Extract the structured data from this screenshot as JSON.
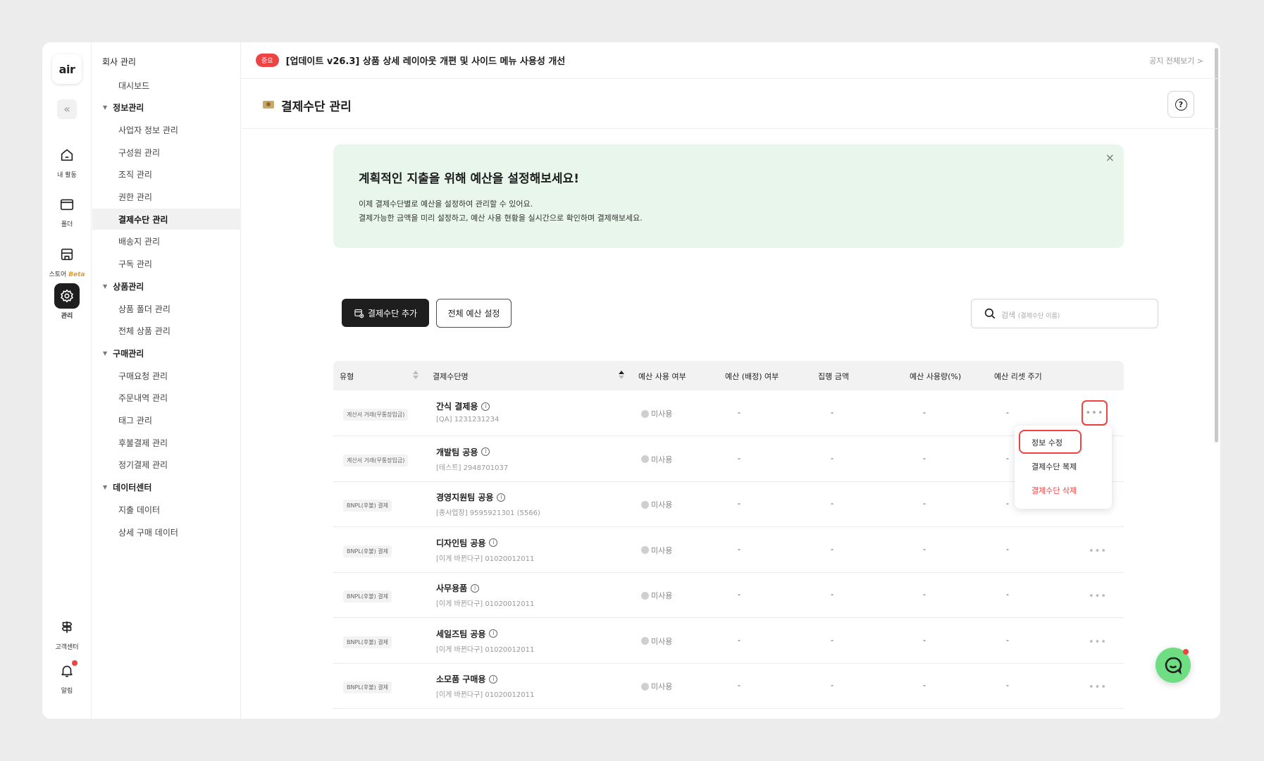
{
  "rail": {
    "logo": "air",
    "items": [
      {
        "label": "내 활동",
        "icon": "home-icon"
      },
      {
        "label": "폴더",
        "icon": "folder-icon"
      },
      {
        "label": "스토어",
        "badge": "Beta",
        "icon": "store-icon"
      },
      {
        "label": "관리",
        "icon": "gear-icon"
      }
    ],
    "bottom": [
      {
        "label": "고객센터",
        "icon": "signpost-icon"
      },
      {
        "label": "알림",
        "icon": "bell-icon"
      }
    ]
  },
  "sidebar": {
    "title": "회사 관리",
    "items": [
      {
        "label": "대시보드",
        "type": "sub"
      },
      {
        "label": "정보관리",
        "type": "section"
      },
      {
        "label": "사업자 정보 관리",
        "type": "sub"
      },
      {
        "label": "구성원 관리",
        "type": "sub"
      },
      {
        "label": "조직 관리",
        "type": "sub"
      },
      {
        "label": "권한 관리",
        "type": "sub"
      },
      {
        "label": "결제수단 관리",
        "type": "sub",
        "active": true
      },
      {
        "label": "배송지 관리",
        "type": "sub"
      },
      {
        "label": "구독 관리",
        "type": "sub"
      },
      {
        "label": "상품관리",
        "type": "section"
      },
      {
        "label": "상품 폴더 관리",
        "type": "sub"
      },
      {
        "label": "전체 상품 관리",
        "type": "sub"
      },
      {
        "label": "구매관리",
        "type": "section"
      },
      {
        "label": "구매요청 관리",
        "type": "sub"
      },
      {
        "label": "주문내역 관리",
        "type": "sub"
      },
      {
        "label": "태그 관리",
        "type": "sub"
      },
      {
        "label": "후불결제 관리",
        "type": "sub"
      },
      {
        "label": "정기결제 관리",
        "type": "sub"
      },
      {
        "label": "데이터센터",
        "type": "section"
      },
      {
        "label": "지출 데이터",
        "type": "sub"
      },
      {
        "label": "상세 구매 데이터",
        "type": "sub"
      }
    ]
  },
  "notice": {
    "badge": "중요",
    "text": "[업데이트 v26.3] 상품 상세 레이아웃 개편 및 사이드 메뉴 사용성 개선",
    "view_all": "공지 전체보기 >"
  },
  "page": {
    "title": "결제수단 관리"
  },
  "banner": {
    "title": "계획적인 지출을 위해 예산을 설정해보세요!",
    "line1": "이제 결제수단별로 예산을 설정하여 관리할 수 있어요.",
    "line2": "결제가능한 금액을 미리 설정하고, 예산 사용 현황을 실시간으로 확인하며 결제해보세요."
  },
  "actions": {
    "add": "결제수단 추가",
    "budget": "전체 예산 설정"
  },
  "search": {
    "placeholder": "검색",
    "hint": "(결제수단 이름)"
  },
  "table": {
    "columns": [
      "유형",
      "결제수단명",
      "예산 사용 여부",
      "예산 (배정) 여부",
      "집행 금액",
      "예산 사용량(%)",
      "예산 리셋 주기"
    ],
    "rows": [
      {
        "type": "계산서 거래(무통장입금)",
        "name": "간식 결제용",
        "sub": "[QA] 1231231234",
        "use": "미사용",
        "assigned": "-",
        "amount": "-",
        "usage": "-",
        "reset": "-"
      },
      {
        "type": "계산서 거래(무통장입금)",
        "name": "개발팀 공용",
        "sub": "[테스트] 2948701037",
        "use": "미사용",
        "assigned": "-",
        "amount": "-",
        "usage": "-",
        "reset": "-"
      },
      {
        "type": "BNPL(후불) 결제",
        "name": "경영지원팀 공용",
        "sub": "[종사업장] 9595921301 (5566)",
        "use": "미사용",
        "assigned": "-",
        "amount": "-",
        "usage": "-",
        "reset": "-"
      },
      {
        "type": "BNPL(후불) 결제",
        "name": "디자인팀 공용",
        "sub": "[이게 바뀐다구] 01020012011",
        "use": "미사용",
        "assigned": "-",
        "amount": "-",
        "usage": "-",
        "reset": "-"
      },
      {
        "type": "BNPL(후불) 결제",
        "name": "사무용품",
        "sub": "[이게 바뀐다구] 01020012011",
        "use": "미사용",
        "assigned": "-",
        "amount": "-",
        "usage": "-",
        "reset": "-"
      },
      {
        "type": "BNPL(후불) 결제",
        "name": "세일즈팀 공용",
        "sub": "[이게 바뀐다구] 01020012011",
        "use": "미사용",
        "assigned": "-",
        "amount": "-",
        "usage": "-",
        "reset": "-"
      },
      {
        "type": "BNPL(후불) 결제",
        "name": "소모품 구매용",
        "sub": "[이게 바뀐다구] 01020012011",
        "use": "미사용",
        "assigned": "-",
        "amount": "-",
        "usage": "-",
        "reset": "-"
      }
    ]
  },
  "row_menu": {
    "items": [
      "정보 수정",
      "결제수단 복제",
      "결제수단 삭제"
    ]
  },
  "colors": {
    "accent_red": "#ef4242",
    "banner_bg": "#e8f6eb",
    "chat_green": "#6fde82",
    "dark": "#1e1e1e"
  }
}
